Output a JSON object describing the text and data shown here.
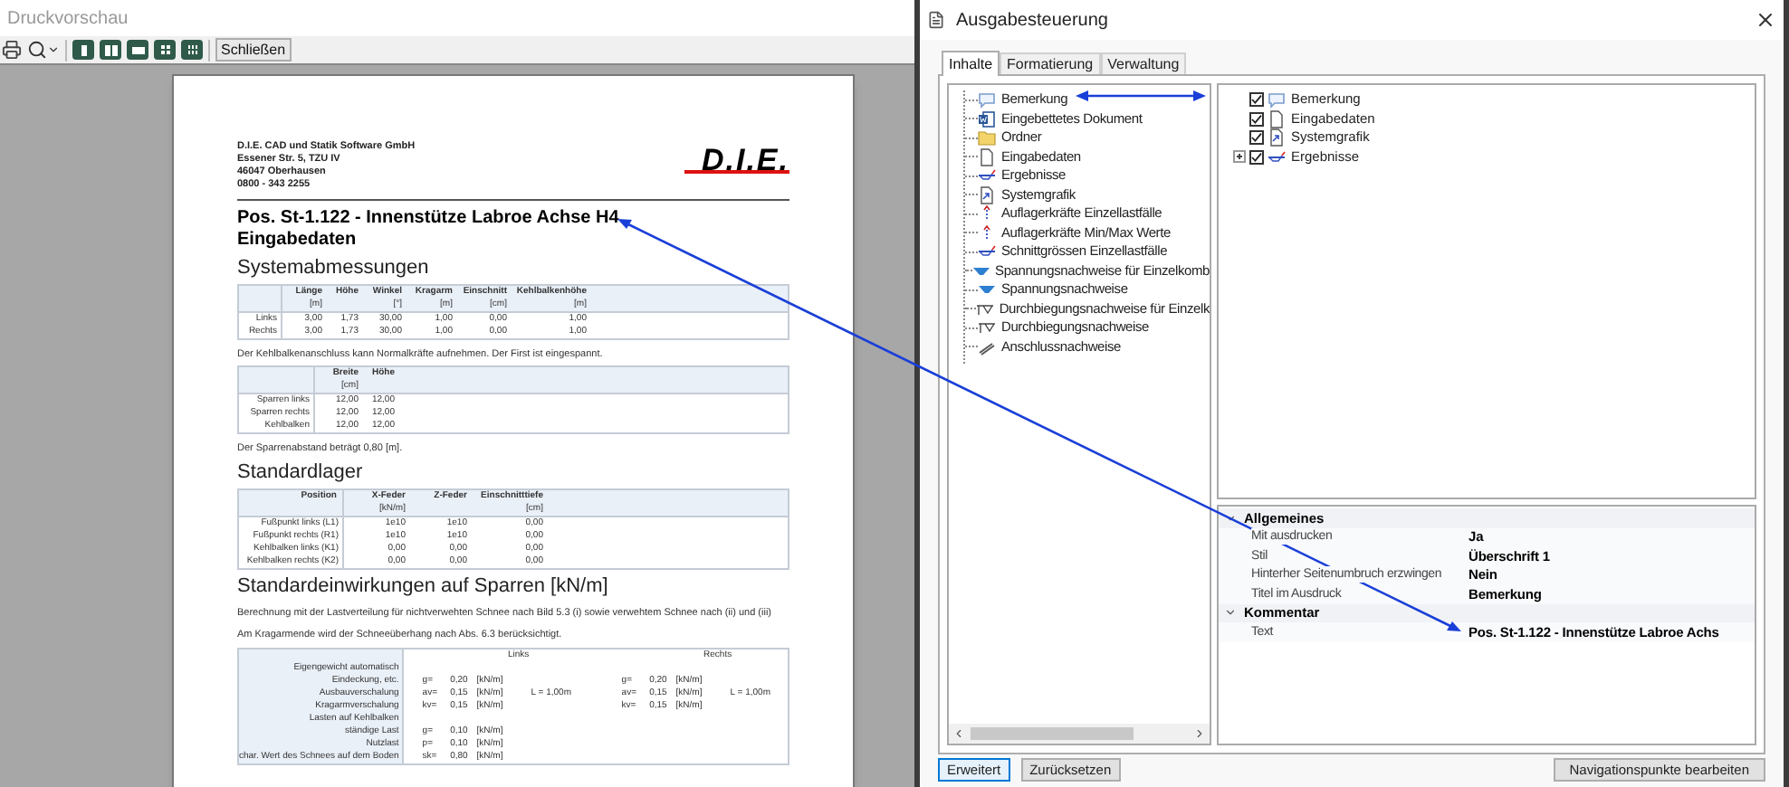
{
  "preview": {
    "title": "Druckvorschau",
    "toolbar": {
      "close_button": "Schließen"
    },
    "document": {
      "company_lines": [
        "D.I.E. CAD und Statik Software GmbH",
        "Essener Str. 5, TZU IV",
        "46047 Oberhausen",
        "0800 - 343 2255"
      ],
      "logo": "D.I.E.",
      "title": "Pos. St-1.122 - Innenstütze Labroe Achse H4",
      "subtitle": "Eingabedaten",
      "blocks": [
        {
          "kind": "heading",
          "text": "Systemabmessungen"
        },
        {
          "kind": "table",
          "columns": [
            null,
            {
              "label": "Länge",
              "unit": "[m]"
            },
            {
              "label": "Höhe"
            },
            {
              "label": "Winkel",
              "unit": "[°]"
            },
            {
              "label": "Kragarm",
              "unit": "[m]"
            },
            {
              "label": "Einschnitt",
              "unit": "[cm]"
            },
            {
              "label": "Kehlbalkenhöhe",
              "unit": "[m]"
            }
          ],
          "rows": [
            [
              "Links",
              "3,00",
              "1,73",
              "30,00",
              "1,00",
              "0,00",
              "1,00"
            ],
            [
              "Rechts",
              "3,00",
              "1,73",
              "30,00",
              "1,00",
              "0,00",
              "1,00"
            ]
          ]
        },
        {
          "kind": "paragraph",
          "text": "Der Kehlbalkenanschluss kann Normalkräfte aufnehmen. Der First ist eingespannt."
        },
        {
          "kind": "table",
          "columns": [
            null,
            {
              "label": "Breite",
              "unit": "[cm]"
            },
            {
              "label": "Höhe"
            }
          ],
          "rows": [
            [
              "Sparren links",
              "12,00",
              "12,00"
            ],
            [
              "Sparren rechts",
              "12,00",
              "12,00"
            ],
            [
              "Kehlbalken",
              "12,00",
              "12,00"
            ]
          ]
        },
        {
          "kind": "paragraph",
          "text": "Der Sparrenabstand beträgt 0,80 [m]."
        },
        {
          "kind": "heading",
          "text": "Standardlager"
        },
        {
          "kind": "table",
          "columns": [
            {
              "label": "Position"
            },
            {
              "label": "X-Feder",
              "unit": "[kN/m]"
            },
            {
              "label": "Z-Feder"
            },
            {
              "label": "Einschnitttiefe",
              "unit": "[cm]"
            }
          ],
          "rows": [
            [
              "Fußpunkt links (L1)",
              "1e10",
              "1e10",
              "0,00"
            ],
            [
              "Fußpunkt rechts (R1)",
              "1e10",
              "1e10",
              "0,00"
            ],
            [
              "Kehlbalken links (K1)",
              "0,00",
              "0,00",
              "0,00"
            ],
            [
              "Kehlbalken rechts (K2)",
              "0,00",
              "0,00",
              "0,00"
            ]
          ]
        },
        {
          "kind": "heading",
          "text": "Standardeinwirkungen auf Sparren [kN/m]"
        },
        {
          "kind": "paragraph",
          "text": "Berechnung mit der Lastverteilung für nichtverwehten Schnee nach Bild 5.3 (i) sowie verwehtem Schnee nach (ii) und (iii)"
        },
        {
          "kind": "paragraph",
          "text": "Am Kragarmende wird der Schneeüberhang nach Abs. 6.3 berücksichtigt."
        },
        {
          "kind": "load_table",
          "groups": [
            "Links",
            "Rechts"
          ],
          "rows": [
            {
              "label": "Eigengewicht automatisch",
              "links": [],
              "rechts": []
            },
            {
              "label": "Eindeckung, etc.",
              "links": [
                "g=",
                "0,20",
                "[kN/m]"
              ],
              "rechts": [
                "g=",
                "0,20",
                "[kN/m]"
              ]
            },
            {
              "label": "Ausbauverschalung",
              "links": [
                "av=",
                "0,15",
                "[kN/m]",
                "L = 1,00m"
              ],
              "rechts": [
                "av=",
                "0,15",
                "[kN/m]",
                "L = 1,00m"
              ]
            },
            {
              "label": "Kragarmverschalung",
              "links": [
                "kv=",
                "0,15",
                "[kN/m]"
              ],
              "rechts": [
                "kv=",
                "0,15",
                "[kN/m]"
              ]
            },
            {
              "label": "Lasten auf Kehlbalken",
              "links": [],
              "rechts": []
            },
            {
              "label": "ständige Last",
              "links": [
                "g=",
                "0,10",
                "[kN/m]"
              ],
              "rechts": []
            },
            {
              "label": "Nutzlast",
              "links": [
                "p=",
                "0,10",
                "[kN/m]"
              ],
              "rechts": []
            },
            {
              "label": "char. Wert des Schnees auf dem Boden",
              "links": [
                "sk=",
                "0,80",
                "[kN/m]"
              ],
              "rechts": []
            }
          ]
        }
      ]
    }
  },
  "dialog": {
    "title": "Ausgabesteuerung",
    "tabs": [
      {
        "label": "Inhalte",
        "selected": true
      },
      {
        "label": "Formatierung",
        "selected": false
      },
      {
        "label": "Verwaltung",
        "selected": false
      }
    ],
    "palette": [
      {
        "label": "Bemerkung",
        "kind": "comment"
      },
      {
        "label": "Eingebettetes Dokument",
        "kind": "word"
      },
      {
        "label": "Ordner",
        "kind": "folder"
      },
      {
        "label": "Eingabedaten",
        "kind": "document"
      },
      {
        "label": "Ergebnisse",
        "kind": "results"
      },
      {
        "label": "Systemgrafik",
        "kind": "graphic"
      },
      {
        "label": "Auflagerkräfte Einzellastfälle",
        "kind": "support"
      },
      {
        "label": "Auflagerkräfte Min/Max Werte",
        "kind": "support"
      },
      {
        "label": "Schnittgrössen Einzellastfälle",
        "kind": "results"
      },
      {
        "label": "Spannungsnachweise für Einzelkomb",
        "kind": "stress"
      },
      {
        "label": "Spannungsnachweise",
        "kind": "stress"
      },
      {
        "label": "Durchbiegungsnachweise für Einzelk",
        "kind": "deflection"
      },
      {
        "label": "Durchbiegungsnachweise",
        "kind": "deflection"
      },
      {
        "label": "Anschlussnachweise",
        "kind": "connection"
      }
    ],
    "outline": [
      {
        "label": "Bemerkung",
        "kind": "comment",
        "checked": true
      },
      {
        "label": "Eingabedaten",
        "kind": "document",
        "checked": true
      },
      {
        "label": "Systemgrafik",
        "kind": "graphic",
        "checked": true
      },
      {
        "label": "Ergebnisse",
        "kind": "results",
        "checked": true,
        "expanded": false
      }
    ],
    "properties": [
      {
        "title": "Allgemeines",
        "expanded": true,
        "rows": [
          {
            "name": "Mit ausdrucken",
            "value": "Ja"
          },
          {
            "name": "Stil",
            "value": "Überschrift 1"
          },
          {
            "name": "Hinterher Seitenumbruch erzwingen",
            "value": "Nein"
          },
          {
            "name": "Titel im Ausdruck",
            "value": "Bemerkung"
          }
        ]
      },
      {
        "title": "Kommentar",
        "expanded": true,
        "rows": [
          {
            "name": "Text",
            "value": "Pos. St-1.122 - Innenstütze Labroe Achs"
          }
        ]
      }
    ],
    "buttons": [
      {
        "label": "Erweitert",
        "focused": true
      },
      {
        "label": "Zurücksetzen",
        "focused": false
      }
    ],
    "nav_button": "Navigationspunkte bearbeiten"
  }
}
